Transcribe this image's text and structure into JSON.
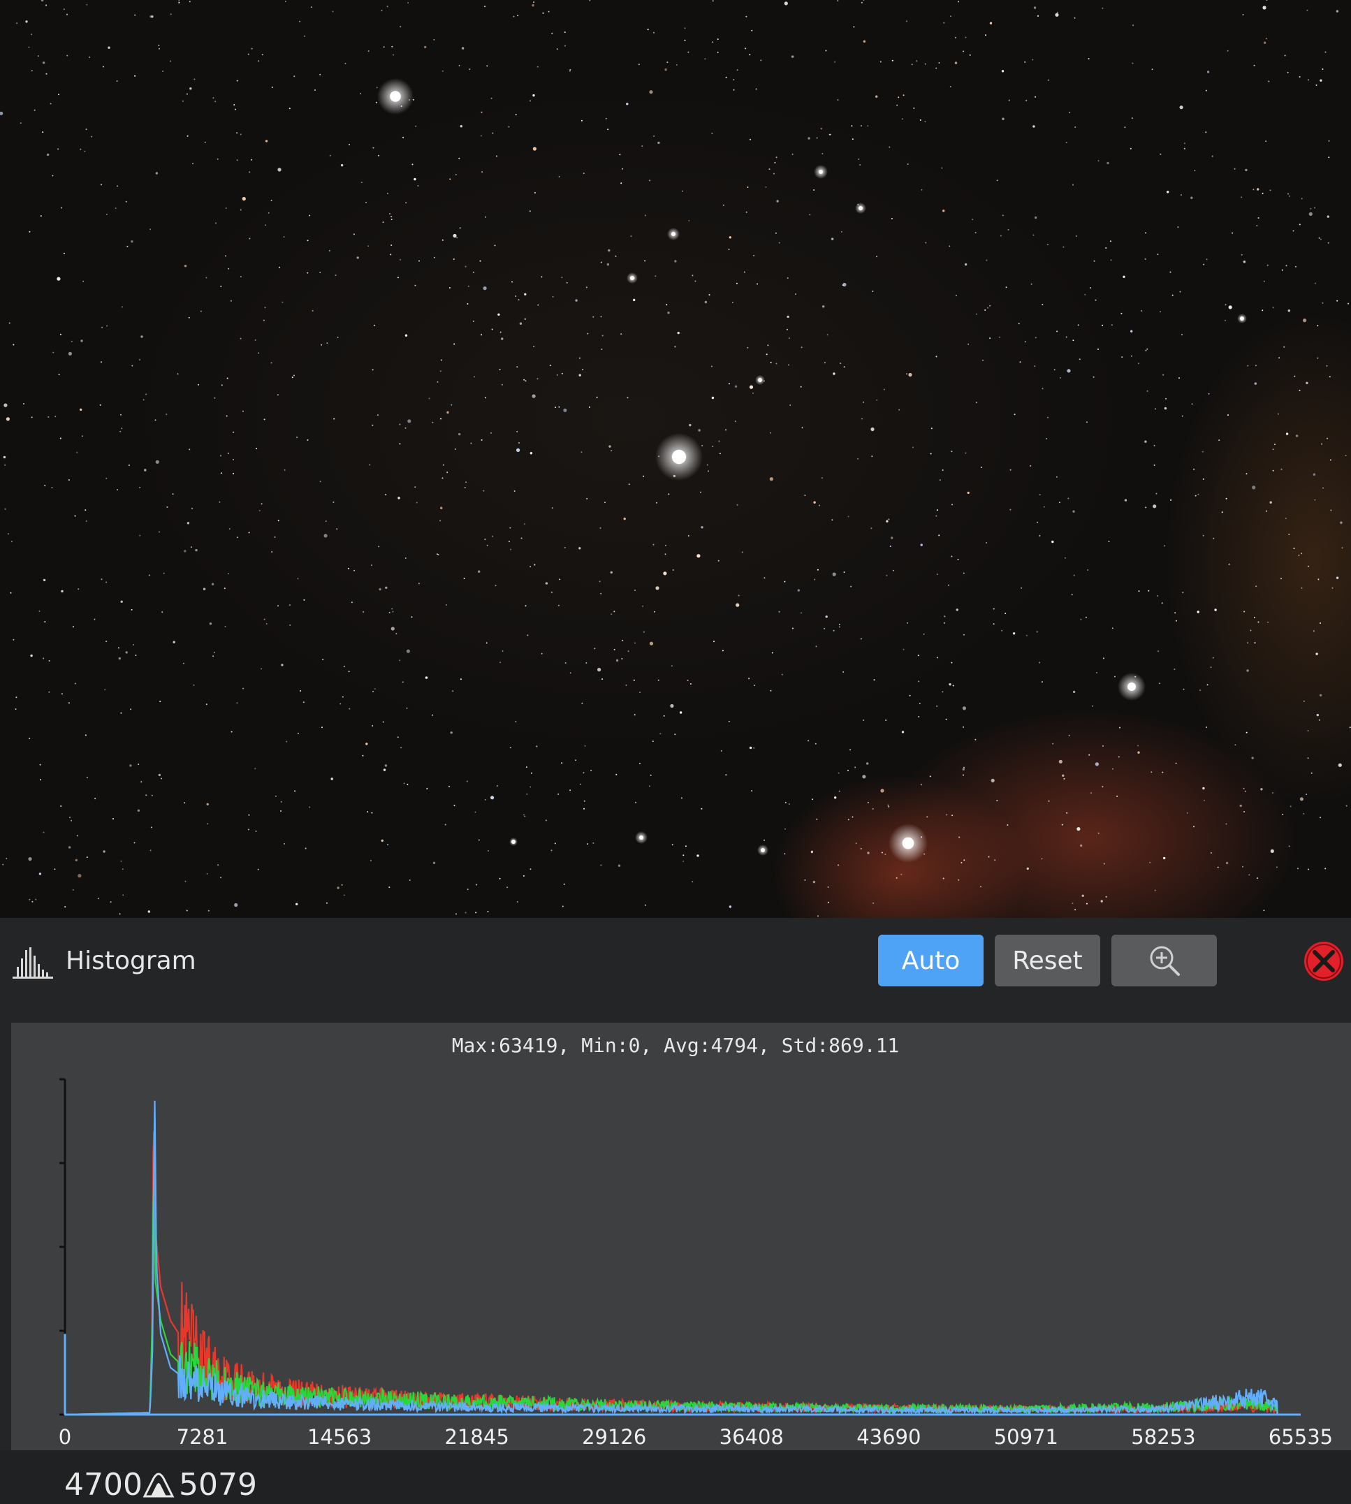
{
  "panel": {
    "title": "Histogram",
    "title_icon": "histogram-icon",
    "buttons": {
      "auto_label": "Auto",
      "reset_label": "Reset",
      "zoom_icon": "zoom-in-icon",
      "close_icon": "close-icon"
    },
    "stats": "Max:63419, Min:0, Avg:4794, Std:869.11",
    "range": {
      "low": "4700",
      "high": "5079",
      "icon": "range-peak-icon"
    }
  },
  "colors": {
    "accent": "#4ea3f7",
    "red_channel": "#e8382c",
    "green_channel": "#29d63c",
    "blue_channel": "#62aefb",
    "close": "#e2202a"
  },
  "chart_data": {
    "type": "line",
    "title": "Max:63419, Min:0, Avg:4794, Std:869.11",
    "xlabel": "",
    "ylabel": "",
    "xlim": [
      0,
      65535
    ],
    "ylim": [
      0,
      1
    ],
    "x_ticks": [
      0,
      7281,
      14563,
      21845,
      29126,
      36408,
      43690,
      50971,
      58253,
      65535
    ],
    "grid": false,
    "series": [
      {
        "color": "#e8382c",
        "points": [
          [
            0,
            0.24
          ],
          [
            4500,
            0
          ],
          [
            4600,
            0.15
          ],
          [
            4700,
            0.93
          ],
          [
            4790,
            0.55
          ],
          [
            5079,
            0.38
          ],
          [
            5600,
            0.28
          ],
          [
            6500,
            0.2
          ],
          [
            7281,
            0.15
          ],
          [
            8500,
            0.1
          ],
          [
            10000,
            0.08
          ],
          [
            12000,
            0.06
          ],
          [
            14563,
            0.05
          ],
          [
            18000,
            0.04
          ],
          [
            21845,
            0.035
          ],
          [
            29126,
            0.025
          ],
          [
            36408,
            0.02
          ],
          [
            43690,
            0.017
          ],
          [
            50971,
            0.015
          ],
          [
            58253,
            0.015
          ],
          [
            62000,
            0.02
          ],
          [
            64000,
            0.015
          ],
          [
            65535,
            0
          ]
        ]
      },
      {
        "color": "#29d63c",
        "points": [
          [
            0,
            0.24
          ],
          [
            4500,
            0
          ],
          [
            4650,
            0.32
          ],
          [
            4700,
            0.8
          ],
          [
            4790,
            0.4
          ],
          [
            5079,
            0.28
          ],
          [
            5600,
            0.18
          ],
          [
            6500,
            0.13
          ],
          [
            7281,
            0.11
          ],
          [
            8500,
            0.08
          ],
          [
            10000,
            0.06
          ],
          [
            12000,
            0.05
          ],
          [
            14563,
            0.045
          ],
          [
            18000,
            0.04
          ],
          [
            21845,
            0.035
          ],
          [
            29126,
            0.025
          ],
          [
            36408,
            0.02
          ],
          [
            43690,
            0.017
          ],
          [
            50971,
            0.016
          ],
          [
            58253,
            0.02
          ],
          [
            62000,
            0.03
          ],
          [
            64000,
            0.025
          ],
          [
            65535,
            0
          ]
        ]
      },
      {
        "color": "#62aefb",
        "points": [
          [
            0,
            0.24
          ],
          [
            4500,
            0
          ],
          [
            4650,
            0.2
          ],
          [
            4750,
            0.99
          ],
          [
            4850,
            0.45
          ],
          [
            5079,
            0.24
          ],
          [
            5600,
            0.14
          ],
          [
            6500,
            0.1
          ],
          [
            7281,
            0.08
          ],
          [
            8500,
            0.06
          ],
          [
            10000,
            0.045
          ],
          [
            12000,
            0.035
          ],
          [
            14563,
            0.03
          ],
          [
            18000,
            0.025
          ],
          [
            21845,
            0.02
          ],
          [
            29126,
            0.017
          ],
          [
            36408,
            0.015
          ],
          [
            43690,
            0.013
          ],
          [
            50971,
            0.012
          ],
          [
            58253,
            0.014
          ],
          [
            62000,
            0.04
          ],
          [
            63419,
            0.05
          ],
          [
            64000,
            0.03
          ],
          [
            65535,
            0
          ]
        ]
      }
    ]
  }
}
